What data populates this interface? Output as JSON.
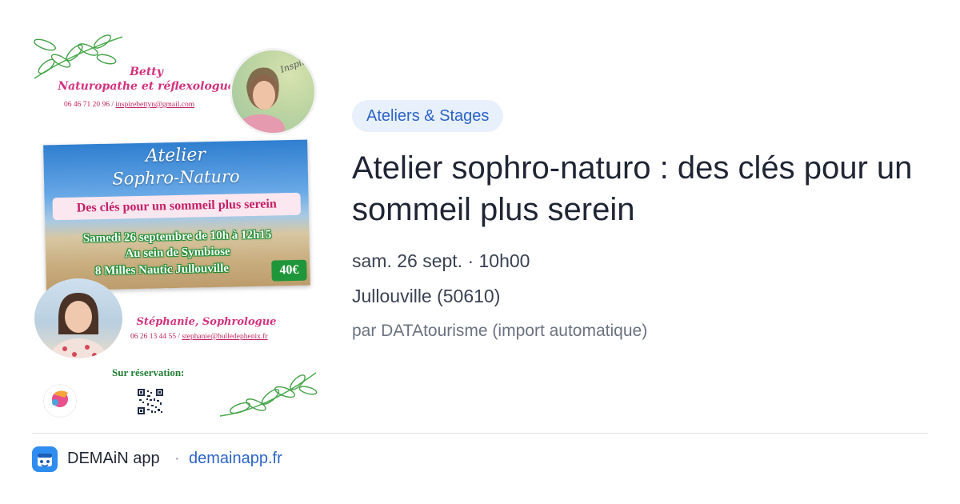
{
  "poster": {
    "betty_name": "Betty",
    "betty_role": "Naturopathe et réflexologue",
    "betty_phone": "06 46 71 20 96",
    "betty_email": "inspirebettyn@gmail.com",
    "badge_text": "InspireB",
    "workshop_line1": "Atelier",
    "workshop_line2": "Sophro-Naturo",
    "banner": "Des clés pour un sommeil plus serein",
    "date_line": "Samedi 26 septembre de 10h à 12h15",
    "venue_line1": "Au sein de Symbiose",
    "venue_line2": "8 Milles Nautic Jullouville",
    "price": "40€",
    "stephanie_role": "Stéphanie, Sophrologue",
    "stephanie_phone": "06 26 13 44 55",
    "stephanie_email": "stephanie@bulledephenix.fr",
    "reservation": "Sur réservation:"
  },
  "event": {
    "category": "Ateliers & Stages",
    "title": "Atelier sophro-naturo : des clés pour un sommeil plus serein",
    "datetime": "sam. 26 sept. · 10h00",
    "location": "Jullouville (50610)",
    "organizer": "par DATAtourisme (import automatique)"
  },
  "footer": {
    "app_name": "DEMAiN app",
    "separator": "·",
    "domain": "demainapp.fr",
    "icon": "demain-app-icon"
  },
  "colors": {
    "accent": "#2c64c6",
    "tag_bg": "#e8f0fb",
    "poster_pink": "#d2327f",
    "poster_green": "#20963a"
  }
}
